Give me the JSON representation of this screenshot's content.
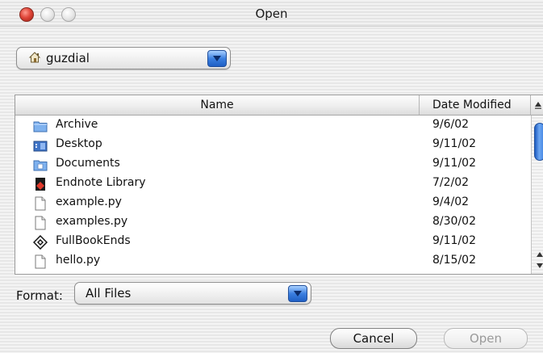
{
  "window": {
    "title": "Open"
  },
  "location": {
    "selected": "guzdial",
    "icon": "home-icon"
  },
  "file_list": {
    "columns": [
      "Name",
      "Date Modified"
    ],
    "rows": [
      {
        "name": "Archive",
        "date": "9/6/02",
        "icon": "folder-icon"
      },
      {
        "name": "Desktop",
        "date": "9/11/02",
        "icon": "desktop-folder-icon"
      },
      {
        "name": "Documents",
        "date": "9/11/02",
        "icon": "documents-folder-icon"
      },
      {
        "name": "Endnote Library",
        "date": "7/2/02",
        "icon": "endnote-icon"
      },
      {
        "name": "example.py",
        "date": "9/4/02",
        "icon": "document-icon"
      },
      {
        "name": "examples.py",
        "date": "8/30/02",
        "icon": "document-icon"
      },
      {
        "name": "FullBookEnds",
        "date": "9/11/02",
        "icon": "application-icon"
      },
      {
        "name": "hello.py",
        "date": "8/15/02",
        "icon": "document-icon"
      }
    ]
  },
  "format": {
    "label": "Format:",
    "selected": "All Files"
  },
  "buttons": {
    "cancel": "Cancel",
    "open": "Open"
  },
  "colors": {
    "accent_blue": "#3b7fe0",
    "close_red": "#e0473a"
  }
}
